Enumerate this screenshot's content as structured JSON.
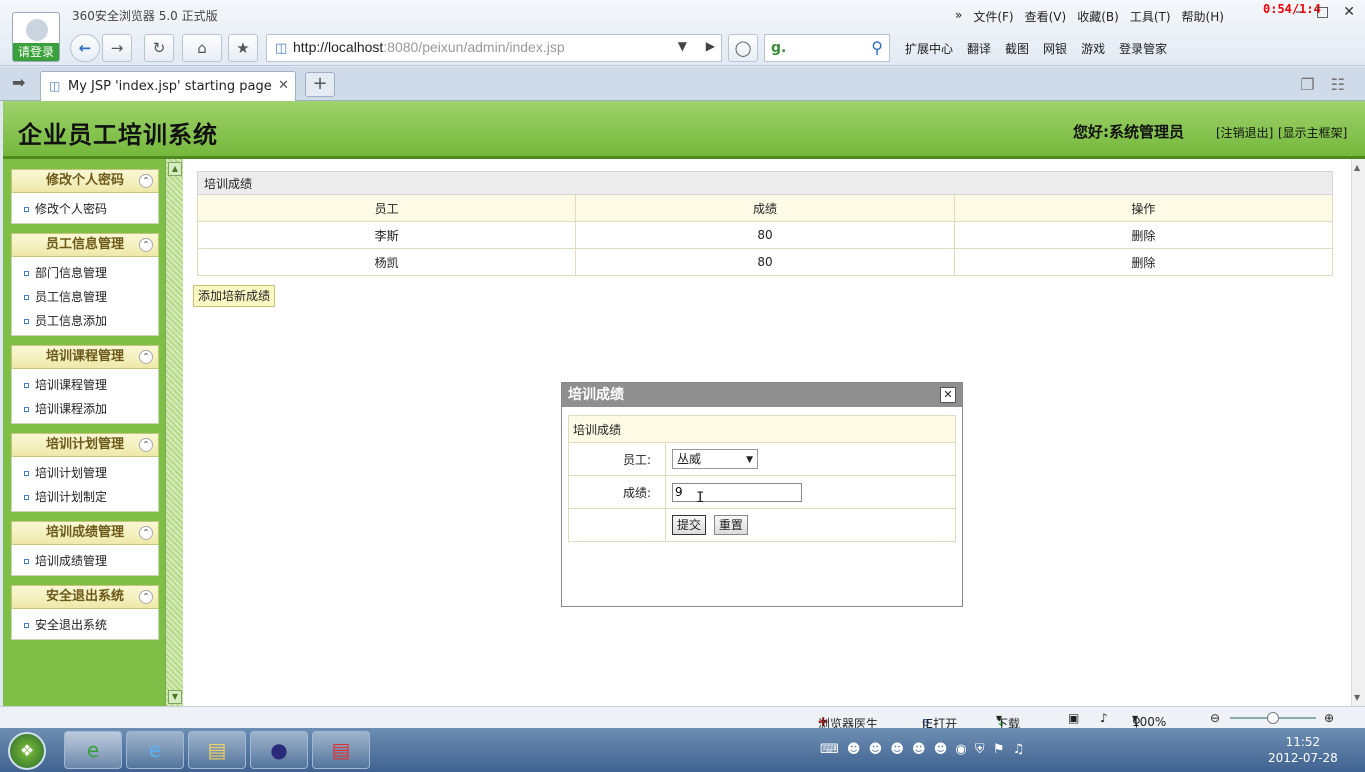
{
  "browser": {
    "title": "360安全浏览器 5.0 正式版",
    "login_label": "请登录",
    "menu": [
      "文件(F)",
      "查看(V)",
      "收藏(B)",
      "工具(T)",
      "帮助(H)"
    ],
    "menu_more": "»",
    "recording_time": "0:54/1:4",
    "url_host": "http://localhost",
    "url_rest": ":8080/peixun/admin/index.jsp",
    "toolbar": [
      "扩展中心",
      "翻译",
      "截图",
      "网银",
      "游戏",
      "登录管家"
    ],
    "tab_title": "My JSP 'index.jsp' starting page"
  },
  "app": {
    "title": "企业员工培训系统",
    "greeting": "您好:系统管理员",
    "logout_link": "[注销退出]",
    "frame_link": "[显示主框架]"
  },
  "sidebar": {
    "groups": [
      {
        "title": "修改个人密码",
        "items": [
          "修改个人密码"
        ]
      },
      {
        "title": "员工信息管理",
        "items": [
          "部门信息管理",
          "员工信息管理",
          "员工信息添加"
        ]
      },
      {
        "title": "培训课程管理",
        "items": [
          "培训课程管理",
          "培训课程添加"
        ]
      },
      {
        "title": "培训计划管理",
        "items": [
          "培训计划管理",
          "培训计划制定"
        ]
      },
      {
        "title": "培训成绩管理",
        "items": [
          "培训成绩管理"
        ]
      },
      {
        "title": "安全退出系统",
        "items": [
          "安全退出系统"
        ]
      }
    ]
  },
  "main": {
    "table_caption": "培训成绩",
    "columns": [
      "员工",
      "成绩",
      "操作"
    ],
    "rows": [
      {
        "employee": "李斯",
        "score": "80",
        "action": "删除"
      },
      {
        "employee": "杨凯",
        "score": "80",
        "action": "删除"
      }
    ],
    "add_button": "添加培新成绩"
  },
  "dialog": {
    "title": "培训成绩",
    "form_caption": "培训成绩",
    "employee_label": "员工:",
    "employee_value": "丛威",
    "score_label": "成绩:",
    "score_value": "9",
    "submit": "提交",
    "reset": "重置"
  },
  "statusbar": {
    "doctor": "浏览器医生",
    "ie_open": "IE打开",
    "download": "下载",
    "zoom": "100%",
    "zoom_level": 0.5
  },
  "taskbar": {
    "time": "11:52",
    "date": "2012-07-28"
  }
}
